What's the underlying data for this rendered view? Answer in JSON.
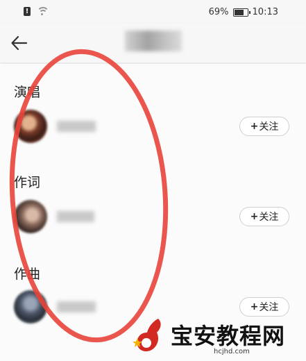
{
  "status_bar": {
    "battery": "69%",
    "time": "10:13",
    "alert_glyph": "!"
  },
  "sections": [
    {
      "title": "演唱",
      "follow_label": "关注"
    },
    {
      "title": "作词",
      "follow_label": "关注"
    },
    {
      "title": "作曲",
      "follow_label": "关注"
    }
  ],
  "watermark": {
    "brand": "宝安教程网",
    "site": "hcjhd.com"
  },
  "colors": {
    "annotation_red": "#e8443a",
    "watermark_red": "#d22a22",
    "watermark_star": "#f5b400"
  }
}
